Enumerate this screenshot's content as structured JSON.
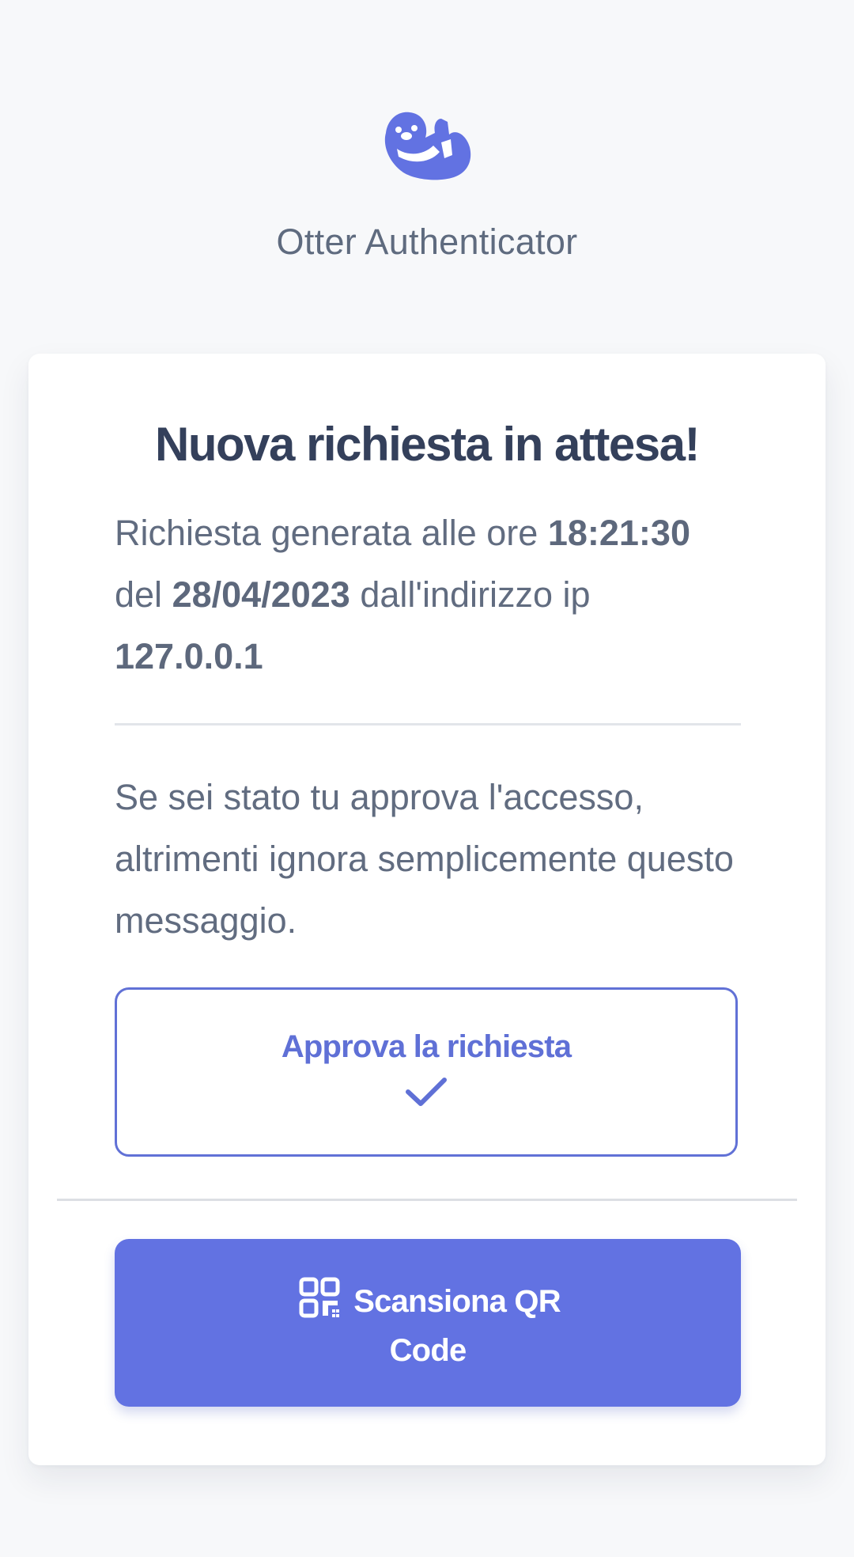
{
  "header": {
    "app_name": "Otter Authenticator",
    "logo_icon": "otter-logo-icon"
  },
  "request": {
    "title": "Nuova richiesta in attesa!",
    "generated_prefix": "Richiesta generata alle ore",
    "time": "18:21:30",
    "date_prefix": "del",
    "date": "28/04/2023",
    "ip_prefix": "dall'indirizzo ip",
    "ip": "127.0.0.1",
    "message": "Se sei stato tu approva l'accesso, altrimenti ignora semplicemente questo messaggio."
  },
  "actions": {
    "approve_label": "Approva la richiesta",
    "approve_icon": "check-icon",
    "scan_label_line1": "Scansiona QR",
    "scan_label_line2": "Code",
    "scan_icon": "qr-code-icon"
  },
  "colors": {
    "accent": "#6272e2",
    "text_dark": "#34405b",
    "text_muted": "#616c80",
    "background": "#f7f8fa"
  }
}
